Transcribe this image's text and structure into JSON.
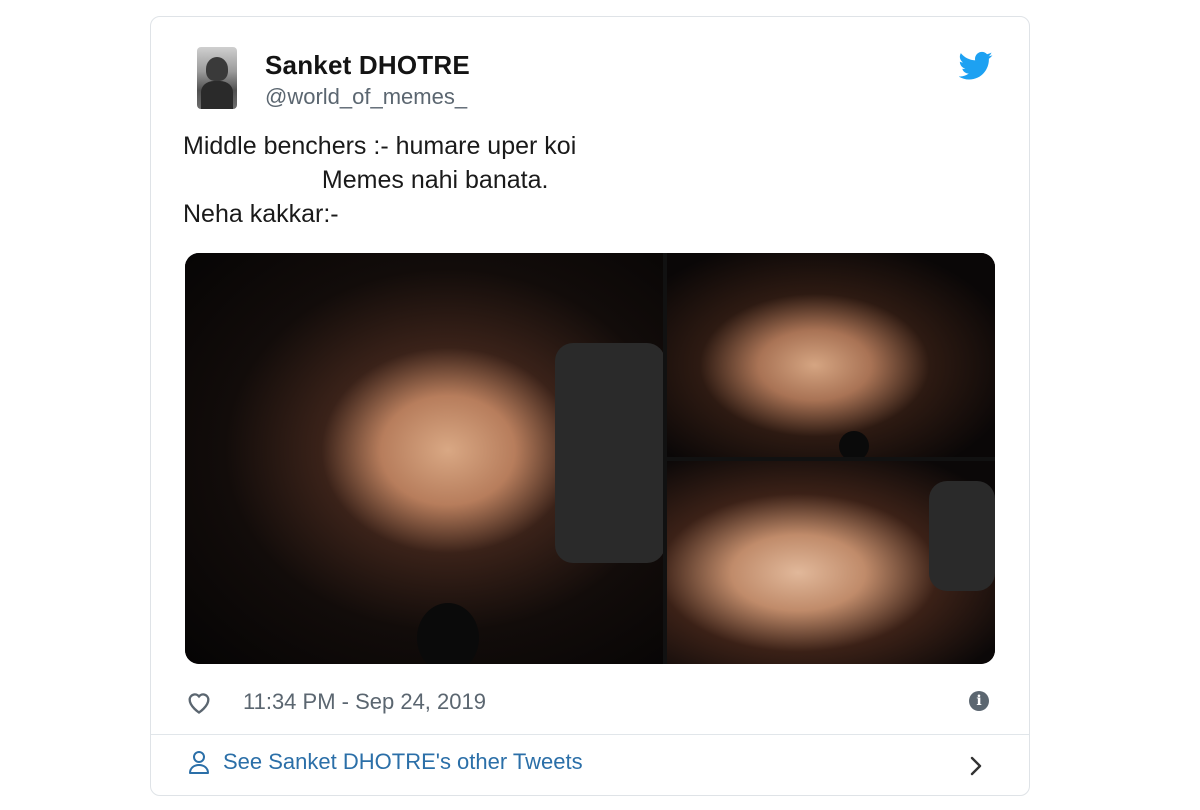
{
  "tweet": {
    "author_name": "Sanket DHOTRE",
    "author_handle": "@world_of_memes_",
    "text_lines": [
      "Middle benchers :- humare uper koi",
      "                    Memes nahi banata.",
      "Neha kakkar:-"
    ],
    "timestamp": "11:34 PM - Sep 24, 2019",
    "footer_link": "See Sanket DHOTRE's other Tweets"
  },
  "icons": {
    "brand": "twitter-bird-icon",
    "like": "heart-icon",
    "info": "info-icon",
    "profile": "person-icon",
    "navigate": "chevron-right-icon"
  },
  "colors": {
    "twitter_blue": "#1da1f2",
    "link_blue": "#2b6fa8",
    "muted_text": "#5b6670"
  }
}
